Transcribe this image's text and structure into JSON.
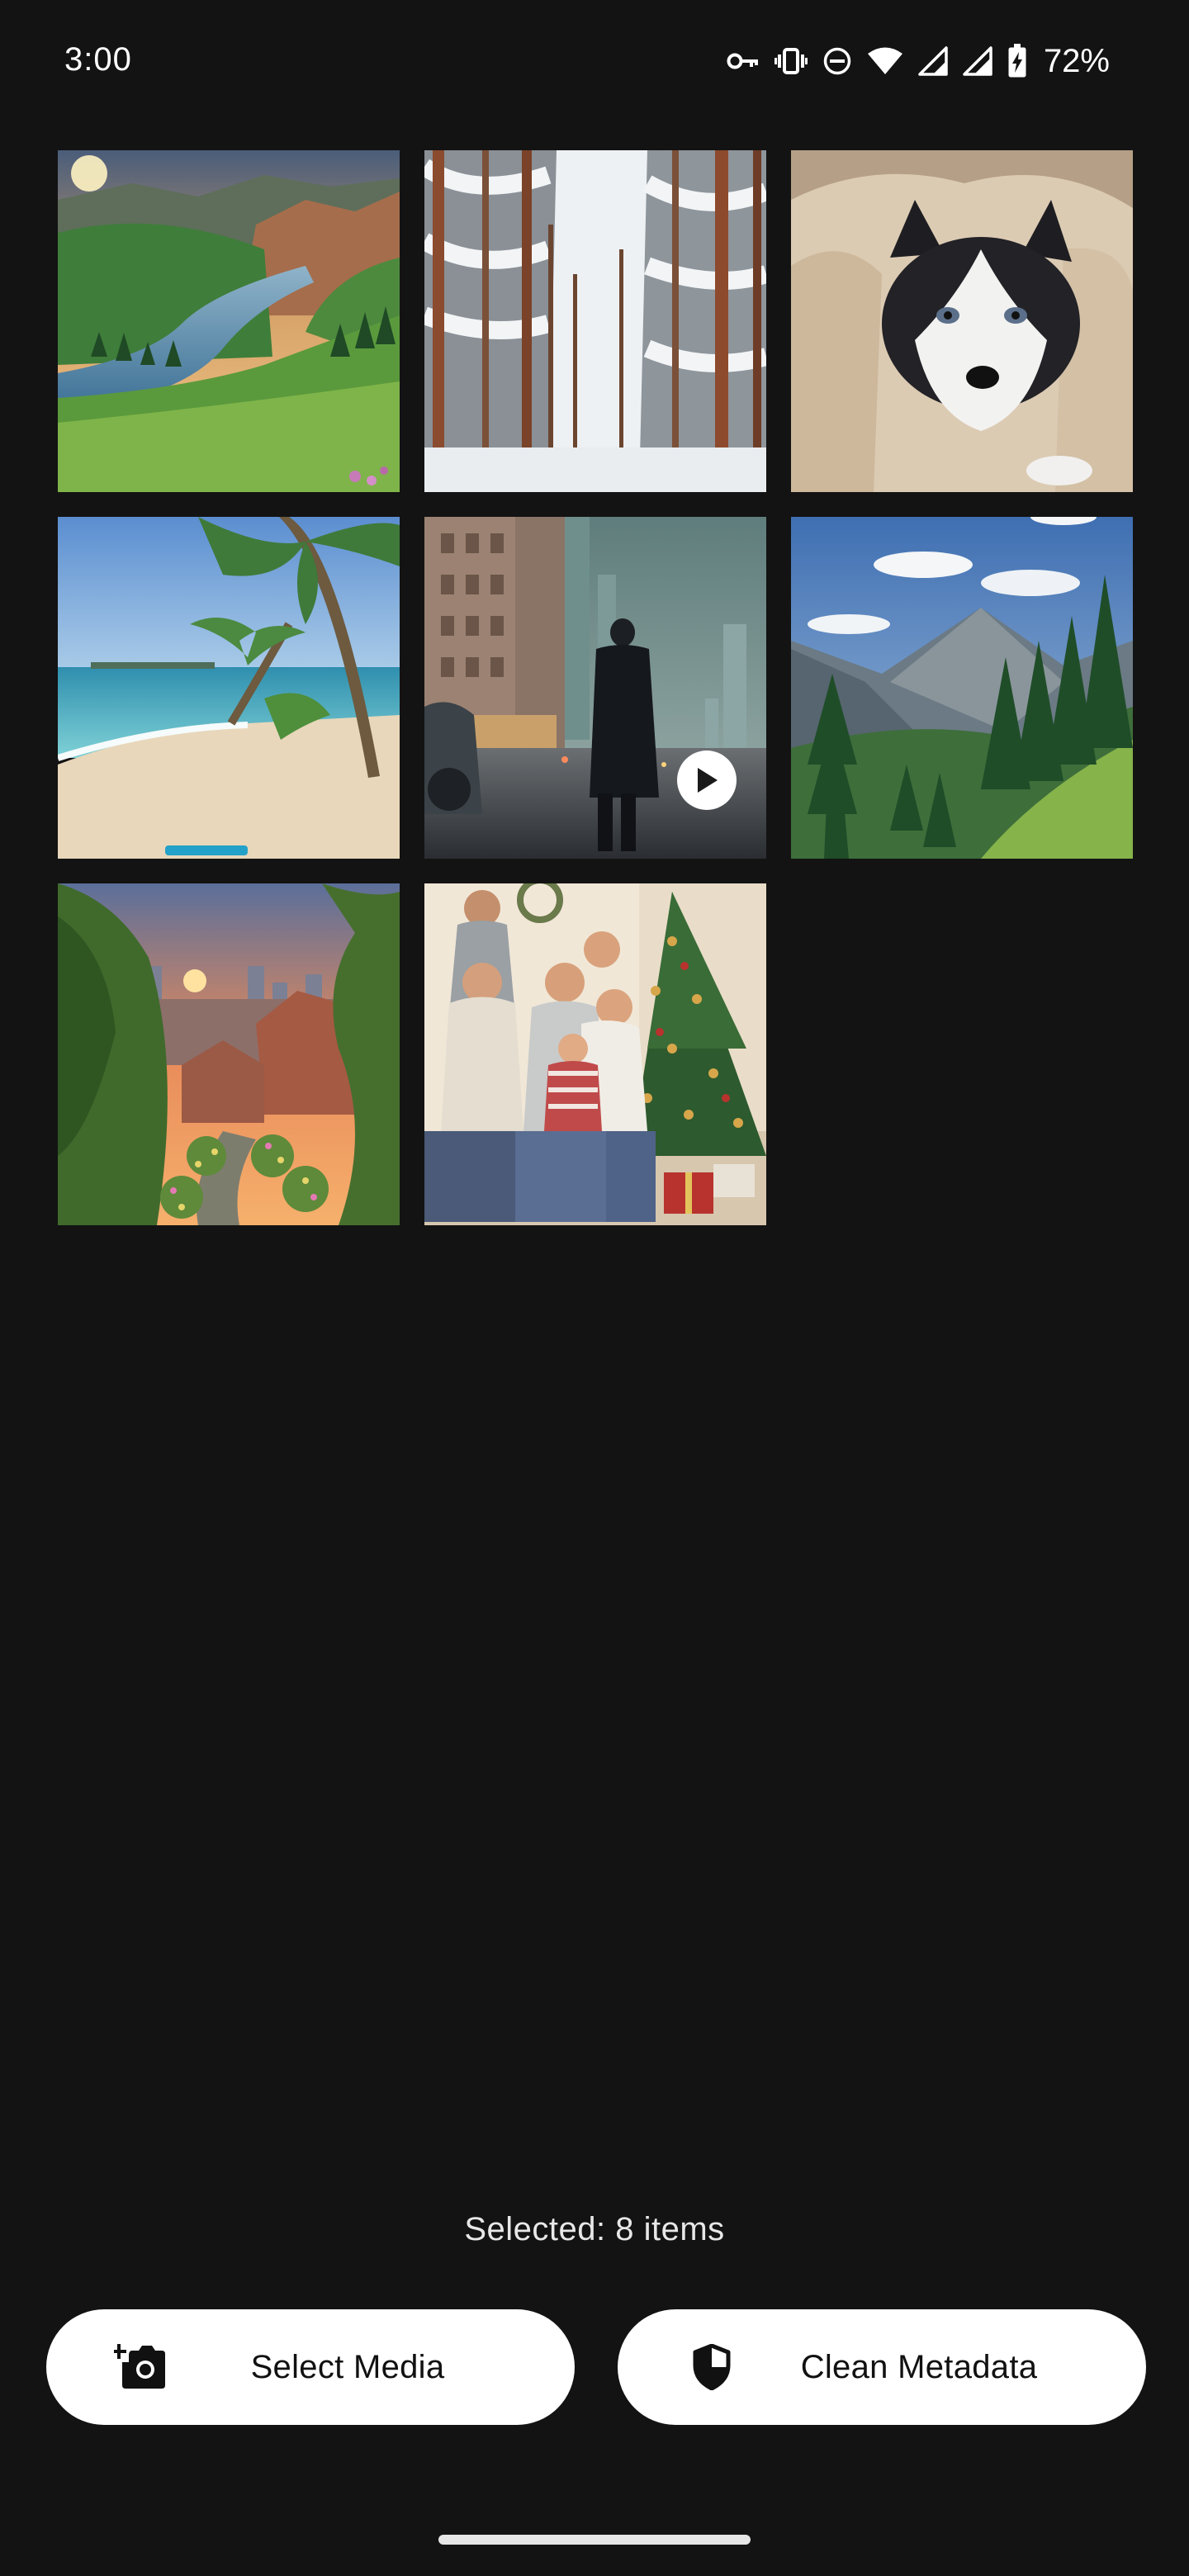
{
  "status_bar": {
    "time": "3:00",
    "battery": "72%",
    "icons": [
      "key-icon",
      "vibrate-icon",
      "do-not-disturb-icon",
      "wifi-icon",
      "cell-signal-icon",
      "cell-signal-icon",
      "battery-charging-icon"
    ]
  },
  "media": [
    {
      "subject": "mountain-river-valley-thumbnail",
      "type": "image"
    },
    {
      "subject": "snowy-forest-thumbnail",
      "type": "image"
    },
    {
      "subject": "husky-in-blanket-thumbnail",
      "type": "image"
    },
    {
      "subject": "tropical-beach-thumbnail",
      "type": "image"
    },
    {
      "subject": "rainy-city-street-thumbnail",
      "type": "video"
    },
    {
      "subject": "mountain-pine-forest-thumbnail",
      "type": "image"
    },
    {
      "subject": "sunset-town-garden-thumbnail",
      "type": "image"
    },
    {
      "subject": "family-christmas-tree-thumbnail",
      "type": "image"
    }
  ],
  "footer": {
    "selected_text": "Selected: 8 items",
    "select_media_label": "Select Media",
    "clean_metadata_label": "Clean Metadata"
  },
  "colors": {
    "background": "#131313",
    "button_background": "#ffffff",
    "button_text": "#111111"
  }
}
